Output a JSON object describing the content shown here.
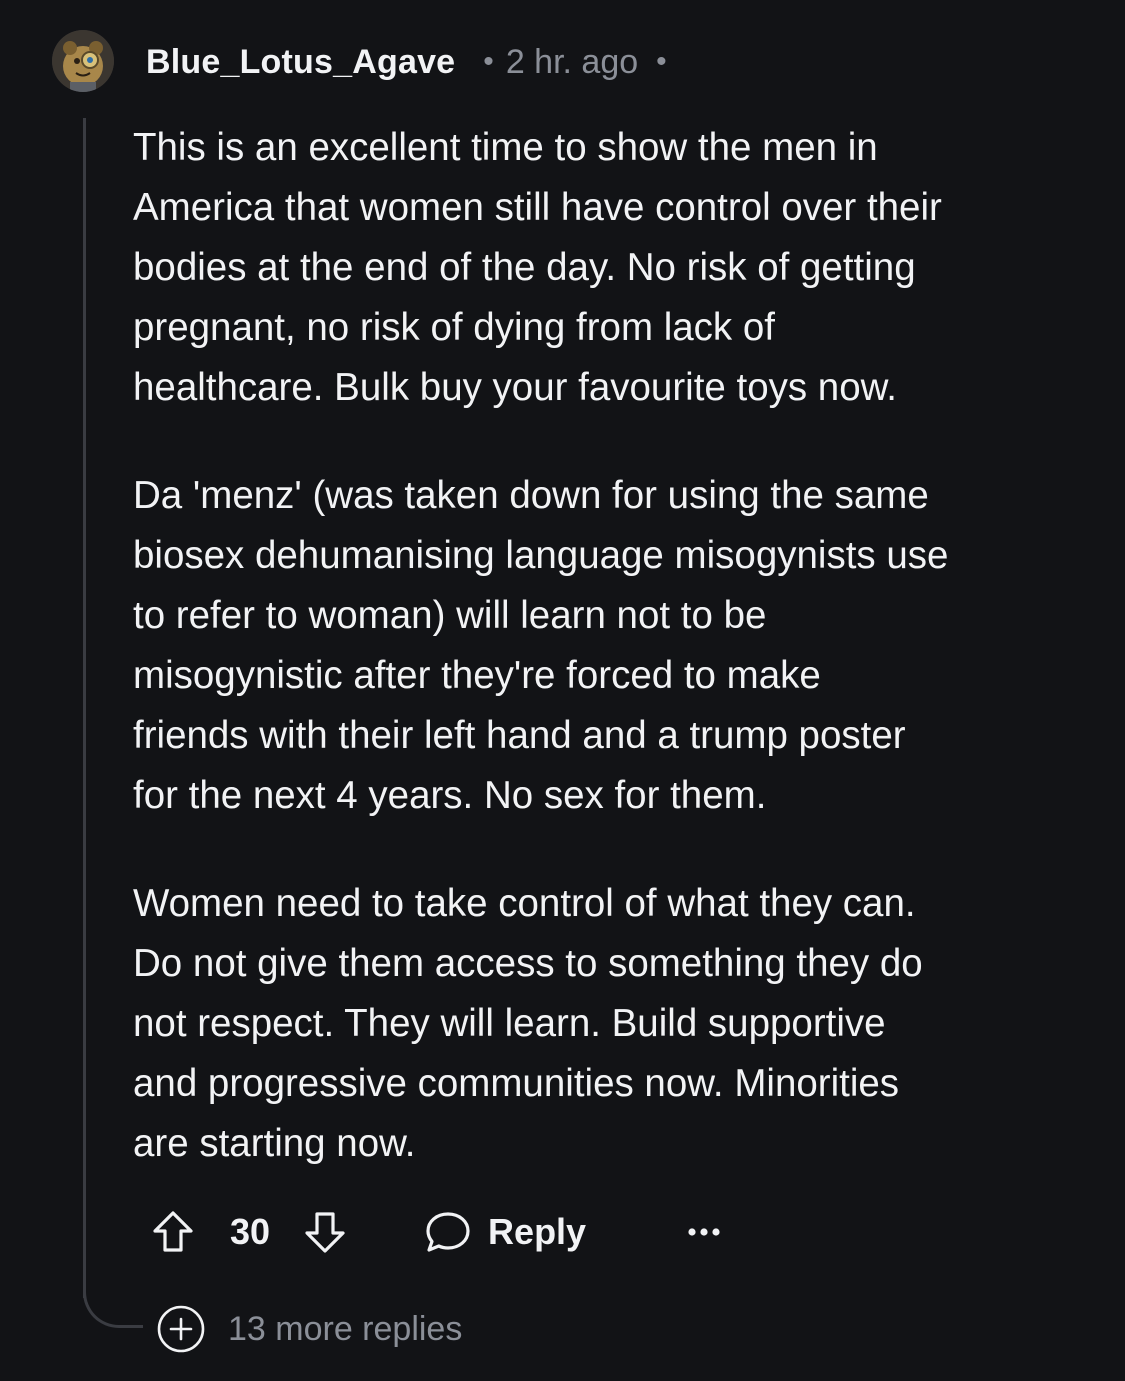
{
  "comment": {
    "username": "Blue_Lotus_Agave",
    "separator": "•",
    "timestamp": "2 hr. ago",
    "paragraphs": [
      "This is an excellent time to show the men in\nAmerica that women still have control over their\nbodies at the end of the day. No risk of getting\npregnant, no risk of dying from lack of\nhealthcare. Bulk buy your favourite toys now.",
      "Da 'menz' (was taken down for using the same\nbiosex dehumanising language misogynists use\nto refer to woman) will learn not to be\nmisogynistic after they're forced to make\nfriends with their left hand and a trump poster\nfor the next 4 years. No sex for them.",
      "Women need to take control of what they can.\nDo not give them access to something they do\nnot respect. They will learn. Build supportive\nand progressive communities now. Minorities\nare starting now."
    ]
  },
  "actions": {
    "upvote_icon": "arrow-up-icon",
    "score": "30",
    "downvote_icon": "arrow-down-icon",
    "reply_icon": "speech-bubble-icon",
    "reply_label": "Reply",
    "more_icon": "ellipsis-icon"
  },
  "thread": {
    "expand_icon": "plus-circle-icon",
    "more_replies_label": "13 more replies"
  },
  "colors": {
    "background": "#121316",
    "text": "#f2f3f5",
    "muted": "#8b8f98",
    "thread_line": "#3a3c42"
  }
}
